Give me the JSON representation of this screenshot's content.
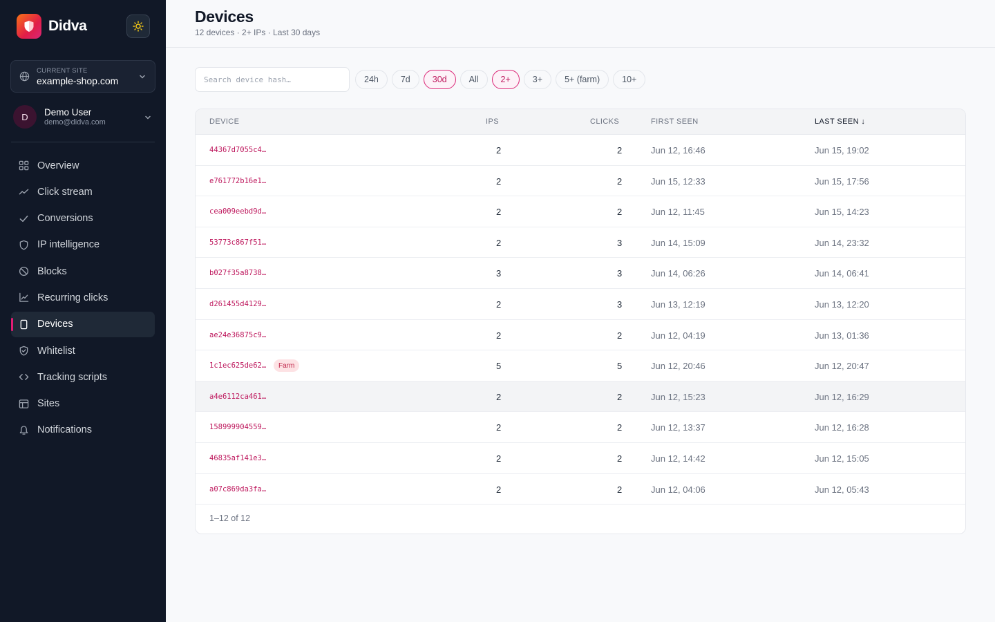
{
  "brand": {
    "name": "Didva"
  },
  "site": {
    "label": "CURRENT SITE",
    "value": "example-shop.com"
  },
  "user": {
    "initial": "D",
    "name": "Demo User",
    "email": "demo@didva.com"
  },
  "nav": [
    {
      "label": "Overview",
      "icon": "grid-icon",
      "active": false
    },
    {
      "label": "Click stream",
      "icon": "trend-icon",
      "active": false
    },
    {
      "label": "Conversions",
      "icon": "check-icon",
      "active": false
    },
    {
      "label": "IP intelligence",
      "icon": "shield-icon",
      "active": false
    },
    {
      "label": "Blocks",
      "icon": "ban-icon",
      "active": false
    },
    {
      "label": "Recurring clicks",
      "icon": "chart-icon",
      "active": false
    },
    {
      "label": "Devices",
      "icon": "device-icon",
      "active": true
    },
    {
      "label": "Whitelist",
      "icon": "shield-check-icon",
      "active": false
    },
    {
      "label": "Tracking scripts",
      "icon": "code-icon",
      "active": false
    },
    {
      "label": "Sites",
      "icon": "layout-icon",
      "active": false
    },
    {
      "label": "Notifications",
      "icon": "bell-icon",
      "active": false
    }
  ],
  "page": {
    "title": "Devices",
    "subtitle": "12 devices · 2+ IPs · Last 30 days"
  },
  "search": {
    "placeholder": "Search device hash…",
    "value": ""
  },
  "range_chips": [
    {
      "label": "24h",
      "active": false
    },
    {
      "label": "7d",
      "active": false
    },
    {
      "label": "30d",
      "active": true
    },
    {
      "label": "All",
      "active": false
    }
  ],
  "ip_chips": [
    {
      "label": "2+",
      "active": true
    },
    {
      "label": "3+",
      "active": false
    },
    {
      "label": "5+ (farm)",
      "active": false
    },
    {
      "label": "10+",
      "active": false
    }
  ],
  "table": {
    "columns": {
      "device": "DEVICE",
      "ips": "IPS",
      "clicks": "CLICKS",
      "first_seen": "FIRST SEEN",
      "last_seen": "LAST SEEN ↓"
    },
    "rows": [
      {
        "hash": "44367d7055c4…",
        "ips": "2",
        "clicks": "2",
        "first": "Jun 12, 16:46",
        "last": "Jun 15, 19:02",
        "badge": ""
      },
      {
        "hash": "e761772b16e1…",
        "ips": "2",
        "clicks": "2",
        "first": "Jun 15, 12:33",
        "last": "Jun 15, 17:56",
        "badge": ""
      },
      {
        "hash": "cea009eebd9d…",
        "ips": "2",
        "clicks": "2",
        "first": "Jun 12, 11:45",
        "last": "Jun 15, 14:23",
        "badge": ""
      },
      {
        "hash": "53773c867f51…",
        "ips": "2",
        "clicks": "3",
        "first": "Jun 14, 15:09",
        "last": "Jun 14, 23:32",
        "badge": ""
      },
      {
        "hash": "b027f35a8738…",
        "ips": "3",
        "clicks": "3",
        "first": "Jun 14, 06:26",
        "last": "Jun 14, 06:41",
        "badge": ""
      },
      {
        "hash": "d261455d4129…",
        "ips": "2",
        "clicks": "3",
        "first": "Jun 13, 12:19",
        "last": "Jun 13, 12:20",
        "badge": ""
      },
      {
        "hash": "ae24e36875c9…",
        "ips": "2",
        "clicks": "2",
        "first": "Jun 12, 04:19",
        "last": "Jun 13, 01:36",
        "badge": ""
      },
      {
        "hash": "1c1ec625de62…",
        "ips": "5",
        "clicks": "5",
        "first": "Jun 12, 20:46",
        "last": "Jun 12, 20:47",
        "badge": "Farm"
      },
      {
        "hash": "a4e6112ca461…",
        "ips": "2",
        "clicks": "2",
        "first": "Jun 12, 15:23",
        "last": "Jun 12, 16:29",
        "badge": ""
      },
      {
        "hash": "158999904559…",
        "ips": "2",
        "clicks": "2",
        "first": "Jun 12, 13:37",
        "last": "Jun 12, 16:28",
        "badge": ""
      },
      {
        "hash": "46835af141e3…",
        "ips": "2",
        "clicks": "2",
        "first": "Jun 12, 14:42",
        "last": "Jun 12, 15:05",
        "badge": ""
      },
      {
        "hash": "a07c869da3fa…",
        "ips": "2",
        "clicks": "2",
        "first": "Jun 12, 04:06",
        "last": "Jun 12, 05:43",
        "badge": ""
      }
    ],
    "footer": "1–12 of 12"
  },
  "colors": {
    "accent": "#db2777",
    "sidebar_bg": "#111827",
    "hash_text": "#be185d",
    "badge_bg": "#fde2e4"
  }
}
